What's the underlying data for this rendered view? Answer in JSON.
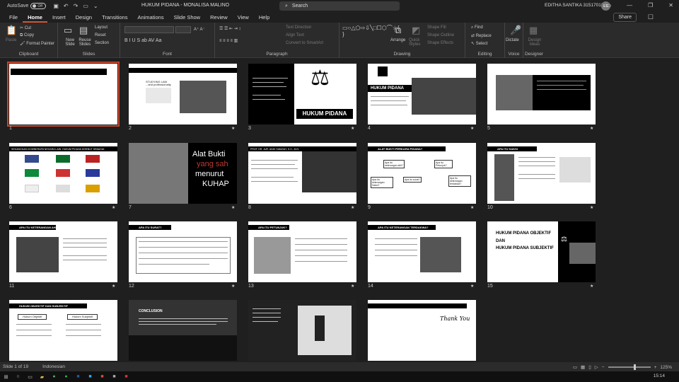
{
  "titlebar": {
    "autosave": "AutoSave",
    "autosave_state": "Off",
    "doc_title": "HUKUM PIDANA - MONALISA MALINO",
    "search": "Search",
    "user": "EDITHA SANTIKA 315170184",
    "initials": "ES"
  },
  "menu": [
    "File",
    "Home",
    "Insert",
    "Design",
    "Transitions",
    "Animations",
    "Slide Show",
    "Review",
    "View",
    "Help"
  ],
  "share": "Share",
  "ribbon": {
    "clipboard": {
      "paste": "Paste",
      "cut": "Cut",
      "copy": "Copy",
      "format_painter": "Format Painter",
      "label": "Clipboard"
    },
    "slides": {
      "new_slide": "New Slide",
      "reuse": "Reuse Slides",
      "layout": "Layout",
      "reset": "Reset",
      "section": "Section",
      "label": "Slides"
    },
    "font": {
      "label": "Font"
    },
    "paragraph": {
      "text_direction": "Text Direction",
      "align_text": "Align Text",
      "smartart": "Convert to SmartArt",
      "label": "Paragraph"
    },
    "drawing": {
      "arrange": "Arrange",
      "quick_styles": "Quick Styles",
      "shape_fill": "Shape Fill",
      "shape_outline": "Shape Outline",
      "shape_effects": "Shape Effects",
      "label": "Drawing"
    },
    "editing": {
      "find": "Find",
      "replace": "Replace",
      "select": "Select",
      "label": "Editing"
    },
    "voice": {
      "dictate": "Dictate",
      "label": "Voice"
    },
    "designer": {
      "design_ideas": "Design Ideas",
      "label": "Designer"
    }
  },
  "slides": [
    {
      "n": "1"
    },
    {
      "n": "2",
      "text": "STUDYING LAW ...and professionally."
    },
    {
      "n": "3",
      "title": "HUKUM PIDANA"
    },
    {
      "n": "4",
      "title": "HUKUM PIDANA"
    },
    {
      "n": "5"
    },
    {
      "n": "6",
      "title": "SEDANGKAN DI BEBERAPA NEGARA LAIN, HUKUM PIDANA DISEBUT SEBAGAI:"
    },
    {
      "n": "7",
      "l1": "Alat Bukti",
      "l2": "yang sah",
      "l3": "menurut",
      "l4": "KUHAP"
    },
    {
      "n": "8",
      "title": "PROF. DR. JUR. ANDI HAMZAH, S.H., M.H."
    },
    {
      "n": "9",
      "title": "ALAT BUKTI PERKARA PIDANA?",
      "b1": "Apa itu keterangan ahli?",
      "b2": "Apa itu Petunjuk?",
      "b3": "Apa itu keterangan Saksi?",
      "b4": "Apa itu surat?",
      "b5": "Apa itu keterangan terdakwa?"
    },
    {
      "n": "10",
      "title": "APA ITU SAKSI"
    },
    {
      "n": "11",
      "title": "APA ITU KETERANGAN AHLI?"
    },
    {
      "n": "12",
      "title": "APA ITU SURAT?"
    },
    {
      "n": "13",
      "title": "APA ITU PETUNJUK?"
    },
    {
      "n": "14",
      "title": "APA ITU KETERANGAN TERDAKWA?"
    },
    {
      "n": "15",
      "l1": "HUKUM PIDANA OBJEKTIF",
      "l2": "DAN",
      "l3": "HUKUM PIDANA SUBJEKTIF"
    },
    {
      "n": "16",
      "title": "HUKUM OBJEKTIF DAN SUBJEKTIF",
      "h1": "Hukum Objektif",
      "h2": "Hukum Subjektif"
    },
    {
      "n": "17",
      "title": "CONCLUSION"
    },
    {
      "n": "18"
    },
    {
      "n": "19",
      "title": "Thank You"
    }
  ],
  "status": {
    "slide": "Slide 1 of 19",
    "lang": "Indonesian",
    "zoom": "125%"
  },
  "clock": "15:14"
}
